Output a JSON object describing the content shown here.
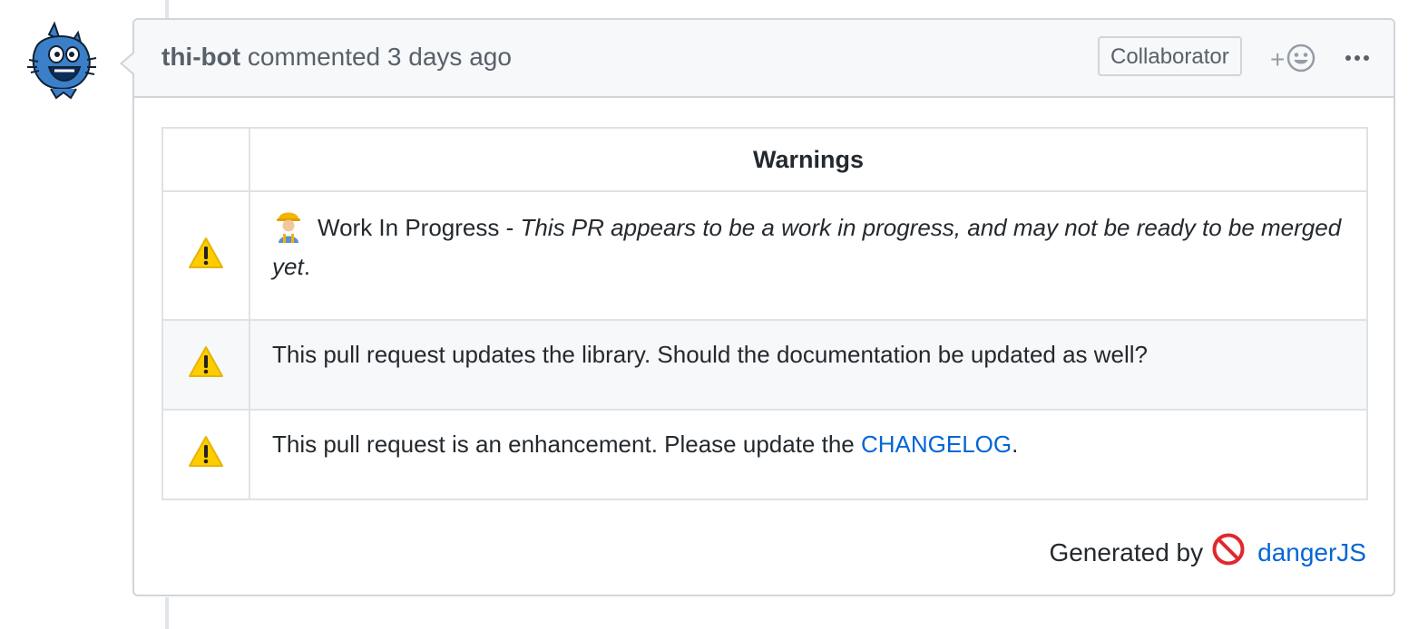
{
  "comment": {
    "author": "thi-bot",
    "action": "commented",
    "time": "3 days ago",
    "badge": "Collaborator",
    "reaction_plus": "+"
  },
  "table": {
    "header": "Warnings",
    "rows": [
      {
        "lead": "Work In Progress - ",
        "emphasis": "This PR appears to be a work in progress, and may not be ready to be merged yet",
        "trail": "."
      },
      {
        "text": "This pull request updates the library. Should the documentation be updated as well?"
      },
      {
        "text_before": "This pull request is an enhancement. Please update the ",
        "link": "CHANGELOG",
        "text_after": "."
      }
    ]
  },
  "footer": {
    "generated_by": "Generated by",
    "tool_link": "dangerJS"
  },
  "colors": {
    "link": "#0366d6",
    "border": "#d1d5da",
    "header_bg": "#f6f8fa",
    "warning": "#ffcc00"
  },
  "icons": [
    "warning-icon",
    "construction-worker-icon",
    "smiley-icon",
    "kebab-menu-icon",
    "no-entry-icon",
    "bot-avatar"
  ]
}
